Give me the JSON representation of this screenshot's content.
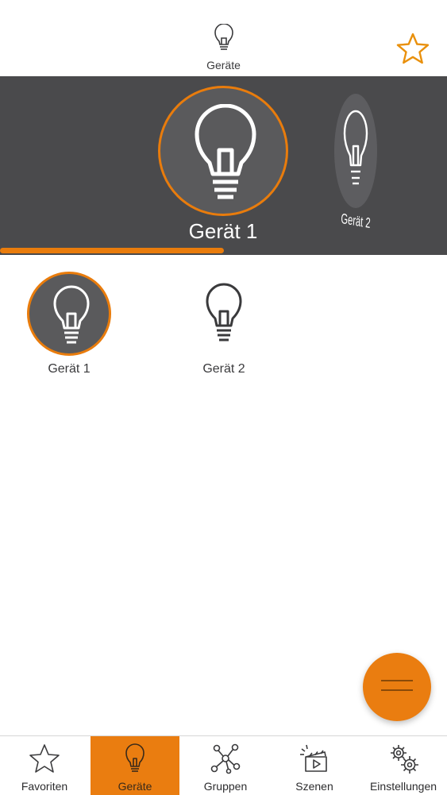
{
  "header": {
    "title": "Geräte",
    "favorite_icon": "star-outline-icon",
    "device_icon": "lightbulb-icon"
  },
  "carousel": {
    "selected_label": "Gerät 1",
    "next_label": "Gerät 2",
    "progress": 0.5,
    "accent": "#e97c0c",
    "background": "#4a4a4c"
  },
  "devices": [
    {
      "label": "Gerät 1",
      "icon": "lightbulb-icon",
      "selected": true
    },
    {
      "label": "Gerät 2",
      "icon": "lightbulb-icon",
      "selected": false
    }
  ],
  "fab": {
    "icon": "menu-icon",
    "color": "#ea7d10"
  },
  "tabbar": {
    "items": [
      {
        "label": "Favoriten",
        "icon": "star-icon"
      },
      {
        "label": "Geräte",
        "icon": "lightbulb-icon",
        "active": true
      },
      {
        "label": "Gruppen",
        "icon": "network-icon"
      },
      {
        "label": "Szenen",
        "icon": "clapperboard-icon"
      },
      {
        "label": "Einstellungen",
        "icon": "gears-icon"
      }
    ]
  }
}
